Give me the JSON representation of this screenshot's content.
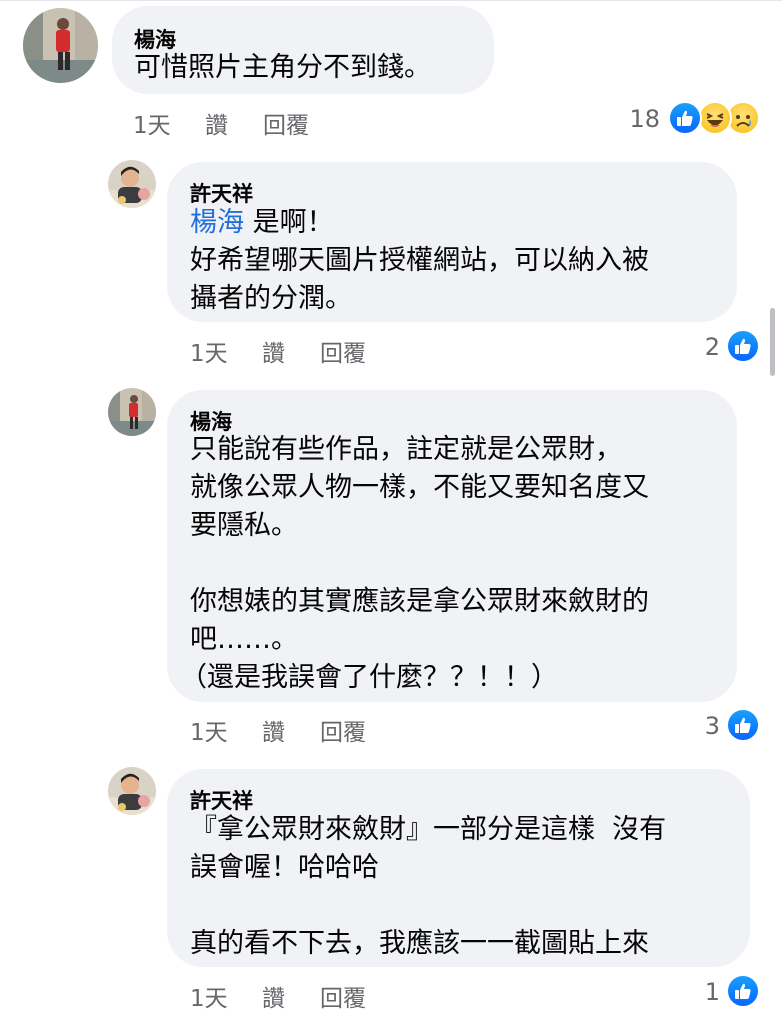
{
  "comments": [
    {
      "author": "楊海",
      "body": [
        "可惜照片主角分不到錢。"
      ],
      "time": "1天",
      "like_label": "讚",
      "reply_label": "回覆",
      "reaction_count": "18",
      "reactions": [
        "like-icon",
        "haha-icon",
        "sad-icon"
      ]
    },
    {
      "author": "許天祥",
      "mention": "楊海",
      "body_first": " 是啊！",
      "body": [
        "好希望哪天圖片授權網站，可以納入被",
        "攝者的分潤。"
      ],
      "time": "1天",
      "like_label": "讚",
      "reply_label": "回覆",
      "reaction_count": "2",
      "reactions": [
        "like-icon"
      ]
    },
    {
      "author": "楊海",
      "body": [
        "只能說有些作品，註定就是公眾財，",
        "就像公眾人物一樣，不能又要知名度又",
        "要隱私。",
        "",
        "你想婊的其實應該是拿公眾財來斂財的",
        "吧……。",
        "（還是我誤會了什麼？？！！）"
      ],
      "time": "1天",
      "like_label": "讚",
      "reply_label": "回覆",
      "reaction_count": "3",
      "reactions": [
        "like-icon"
      ]
    },
    {
      "author": "許天祥",
      "body": [
        "『拿公眾財來斂財』一部分是這樣  沒有",
        "誤會喔！哈哈哈",
        "",
        "真的看不下去，我應該一一截圖貼上來"
      ],
      "time": "1天",
      "like_label": "讚",
      "reply_label": "回覆",
      "reaction_count": "1",
      "reactions": [
        "like-icon"
      ]
    }
  ],
  "colors": {
    "bubble": "#f0f2f5",
    "meta": "#65676b",
    "mention": "#216fdb",
    "like": "#0866ff"
  }
}
